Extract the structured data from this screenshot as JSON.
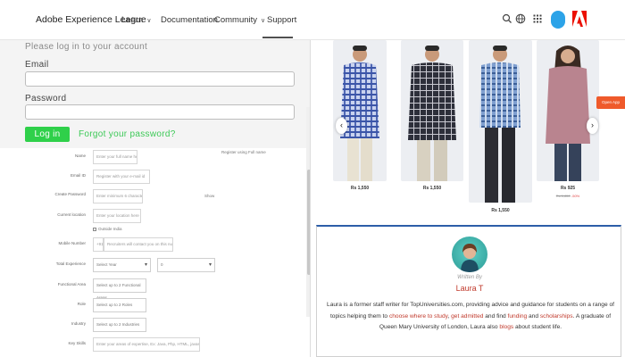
{
  "nav": {
    "brand": "Adobe Experience League",
    "links": [
      {
        "label": "Learn",
        "has_dropdown": true
      },
      {
        "label": "Documentation",
        "has_dropdown": false
      },
      {
        "label": "Community",
        "has_dropdown": true
      },
      {
        "label": "Support",
        "has_dropdown": false,
        "active": true
      }
    ],
    "icons": [
      "search-icon",
      "globe-icon",
      "apps-grid-icon",
      "user-avatar-icon",
      "adobe-logo-icon"
    ],
    "accent_color": "#2ca3e8",
    "adobe_red": "#eb1000"
  },
  "login": {
    "title": "Please log in to your account",
    "email_label": "Email",
    "email_value": "",
    "password_label": "Password",
    "password_value": "",
    "login_button": "Log in",
    "forgot_link": "Forgot your password?",
    "button_color": "#2fd04a"
  },
  "registration": {
    "top_note": "Register using Full name",
    "fields": {
      "name": {
        "label": "Name",
        "placeholder": "Enter your full name here"
      },
      "email": {
        "label": "Email ID",
        "placeholder": "Register with your e-mail id"
      },
      "create_password": {
        "label": "Create Password",
        "placeholder": "Enter minimum 6 characters",
        "note": "Show"
      },
      "current_location": {
        "label": "Current location",
        "placeholder": "Enter your location here",
        "checkbox_label": "Outside India"
      },
      "mobile": {
        "label": "Mobile Number",
        "prefix": "+91",
        "placeholder": "Recruiters will contact you on this number"
      },
      "experience": {
        "label": "Total Experience",
        "years": "Select Year",
        "months": "0"
      },
      "functional_area": {
        "label": "Functional Area",
        "value": "Select up to 2 Functional Areas"
      },
      "role": {
        "label": "Role",
        "value": "Select up to 2 Roles"
      },
      "industry": {
        "label": "Industry",
        "value": "Select up to 2 Industries"
      },
      "key_skills": {
        "label": "Key Skills",
        "placeholder": "Enter your areas of expertise, Ex: Java, Php, HTML, javascript etc."
      }
    }
  },
  "carousel": {
    "side_tab": "Open App",
    "products": [
      {
        "price": "Rs 1,550",
        "strike": "",
        "discount": ""
      },
      {
        "price": "Rs 1,550",
        "strike": "",
        "discount": ""
      },
      {
        "price": "Rs 1,550",
        "strike": "",
        "discount": ""
      },
      {
        "price": "Rs 925",
        "strike": "Rs 1,850",
        "discount": "-50%"
      }
    ]
  },
  "author": {
    "written_by": "Written By",
    "name": "Laura T",
    "bio_parts": [
      {
        "text": "Laura is a former staff writer for TopUniversities.com, providing advice and guidance for students on a range of topics helping them to ",
        "hl": false
      },
      {
        "text": "choose where to study",
        "hl": true
      },
      {
        "text": ", ",
        "hl": false
      },
      {
        "text": "get admitted",
        "hl": true
      },
      {
        "text": " and find ",
        "hl": false
      },
      {
        "text": "funding",
        "hl": true
      },
      {
        "text": " and ",
        "hl": false
      },
      {
        "text": "scholarships",
        "hl": true
      },
      {
        "text": ". A graduate of Queen Mary University of London, Laura also ",
        "hl": false
      },
      {
        "text": "blogs",
        "hl": true
      },
      {
        "text": " about student life.",
        "hl": false
      }
    ],
    "link_color": "#c0392b"
  }
}
